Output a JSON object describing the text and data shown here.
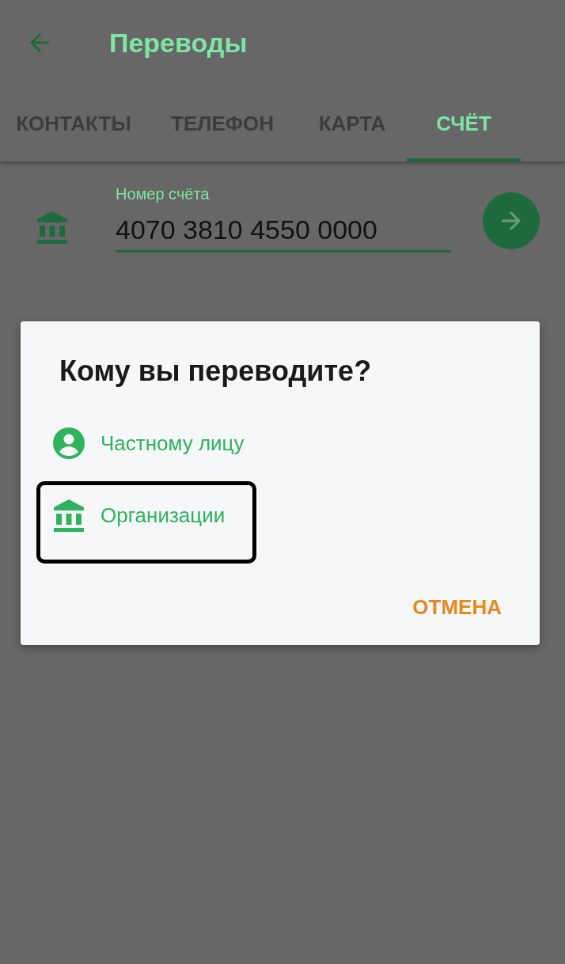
{
  "app_bar": {
    "title": "Переводы"
  },
  "tabs": [
    {
      "label": "КОНТАКТЫ",
      "selected": false
    },
    {
      "label": "ТЕЛЕФОН",
      "selected": false
    },
    {
      "label": "КАРТА",
      "selected": false
    },
    {
      "label": "СЧЁТ",
      "selected": true
    }
  ],
  "account_field": {
    "label": "Номер счёта",
    "value": "4070 3810 4550 0000"
  },
  "dialog": {
    "title": "Кому вы переводите?",
    "options": [
      {
        "kind": "person",
        "label": "Частному лицу",
        "highlighted": false
      },
      {
        "kind": "organization",
        "label": "Организации",
        "highlighted": true
      }
    ],
    "cancel": "ОТМЕНА"
  }
}
